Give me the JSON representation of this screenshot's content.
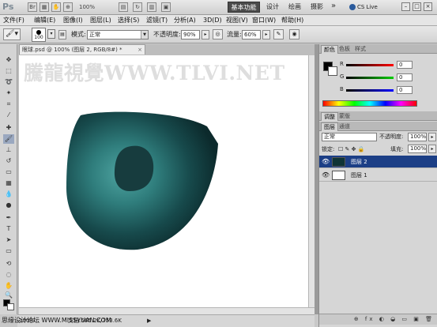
{
  "app": {
    "logo": "Ps",
    "zoom": "100%",
    "workspaces": [
      "基本功能",
      "设计",
      "绘画",
      "摄影"
    ],
    "more": "»",
    "cs_live": "CS Live",
    "window_controls": [
      "–",
      "□",
      "×"
    ]
  },
  "menu": [
    "文件(F)",
    "编辑(E)",
    "图像(I)",
    "图层(L)",
    "选择(S)",
    "滤镜(T)",
    "分析(A)",
    "3D(D)",
    "视图(V)",
    "窗口(W)",
    "帮助(H)"
  ],
  "options": {
    "brush_size": "100",
    "mode_label": "模式:",
    "mode_value": "正常",
    "opacity_label": "不透明度:",
    "opacity_value": "90%",
    "flow_label": "流量:",
    "flow_value": "60%"
  },
  "document": {
    "tab_title": "眼球.psd @ 100% (图层 2, RGB/8#) *",
    "close": "×",
    "watermark": "騰龍視覺WWW.TLVI.NET",
    "status_zoom": "100%",
    "status_doc": "文档:565.2K/753.6K",
    "status_arrow": "▶"
  },
  "color_panel": {
    "tabs": [
      "颜色",
      "色板",
      "样式"
    ],
    "channels": [
      {
        "label": "R",
        "value": "0",
        "color": "#d02020"
      },
      {
        "label": "G",
        "value": "0",
        "color": "#20a020"
      },
      {
        "label": "B",
        "value": "0",
        "color": "#2040d0"
      }
    ]
  },
  "adjust_tabs": [
    "调整",
    "蒙版"
  ],
  "layers_panel": {
    "tabs": [
      "图层",
      "通道"
    ],
    "blend_mode": "正常",
    "opacity_label": "不透明度:",
    "opacity_value": "100%",
    "lock_label": "锁定:",
    "fill_label": "填充:",
    "fill_value": "100%",
    "layers": [
      {
        "name": "图层 2",
        "selected": true
      },
      {
        "name": "图层 1",
        "selected": false
      }
    ],
    "footer_icons": "⊕ fx ◐ ◒ ▭ ▣ 🗑"
  },
  "site_footer": "思缘设计论坛 WWW.MISSYUAN.COM",
  "colors": {
    "eye_outer": "#0c2a2c",
    "eye_highlight": "#4fa5a2",
    "pupil": "#173c3e",
    "selected_layer": "#1c3f86"
  }
}
